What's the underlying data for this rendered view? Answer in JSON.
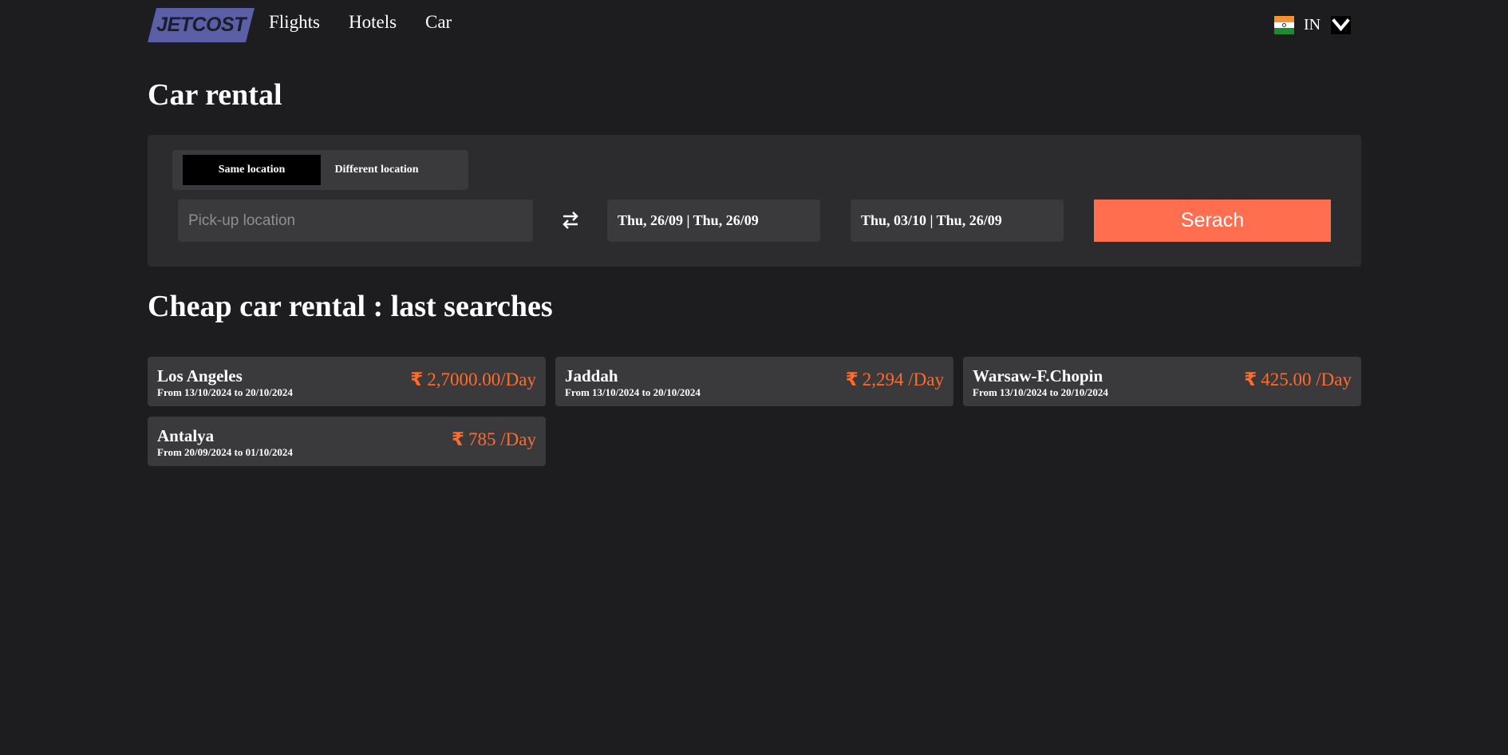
{
  "brand": {
    "logo_text": "JETCOST",
    "logo_color": "#5a5fa6"
  },
  "nav": {
    "flights": "Flights",
    "hotels": "Hotels",
    "car": "Car"
  },
  "locale": {
    "flag_icon": "india-flag-icon",
    "code": "IN"
  },
  "page": {
    "title": "Car rental",
    "last_searches_title": "Cheap car rental : last searches"
  },
  "search": {
    "toggle": {
      "same": "Same location",
      "different": "Different location",
      "selected": "same"
    },
    "pickup_placeholder": "Pick-up location",
    "pickup_date": "Thu, 26/09 | Thu, 26/09",
    "dropoff_date": "Thu, 03/10 | Thu, 26/09",
    "button_label": "Serach",
    "button_color": "#ff6f4f"
  },
  "currency_symbol": "₹",
  "price_color": "#ff6b2c",
  "last_searches": [
    {
      "city": "Los Angeles",
      "dates": "From 13/10/2024 to 20/10/2024",
      "price": "2,7000.00/Day"
    },
    {
      "city": "Jaddah",
      "dates": "From 13/10/2024 to 20/10/2024",
      "price": "2,294 /Day"
    },
    {
      "city": "Warsaw-F.Chopin",
      "dates": "From 13/10/2024 to 20/10/2024",
      "price": "425.00 /Day"
    },
    {
      "city": "Antalya",
      "dates": "From 20/09/2024 to 01/10/2024",
      "price": "785 /Day"
    }
  ]
}
